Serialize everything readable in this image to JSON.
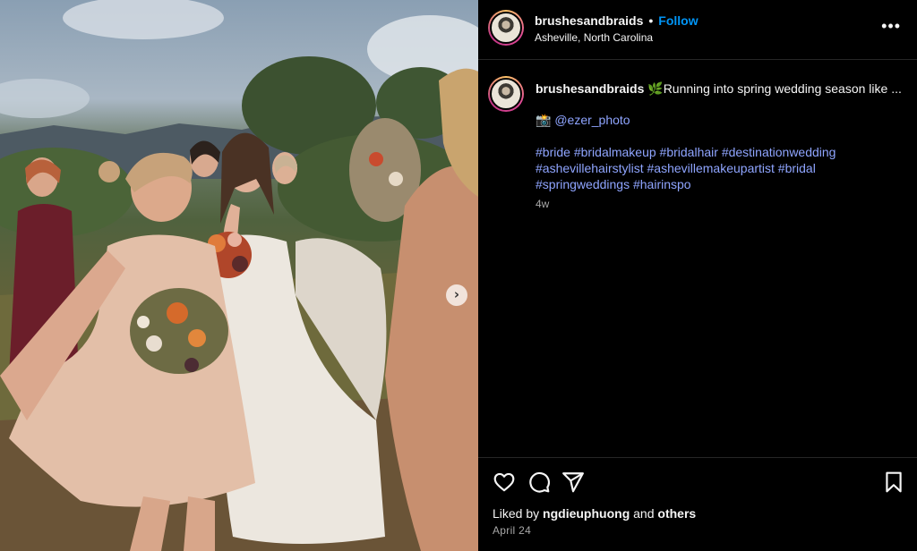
{
  "post": {
    "username": "brushesandbraids",
    "follow_label": "Follow",
    "dot": "•",
    "location": "Asheville, North Carolina",
    "more_label": "•••"
  },
  "caption": {
    "username": "brushesandbraids",
    "intro": "🌿Running into spring wedding season like ...",
    "mention_prefix": "📸 ",
    "mention": "@ezer_photo",
    "hashtags": [
      "#bride",
      "#bridalmakeup",
      "#bridalhair",
      "#destinationwedding",
      "#ashevillehairstylist",
      "#ashevillemakeupartist",
      "#bridal",
      "#springweddings",
      "#hairinspo"
    ],
    "time": "4w"
  },
  "footer": {
    "liked_prefix": "Liked by ",
    "liked_user": "ngdieuphuong",
    "liked_and": " and ",
    "liked_others": "others",
    "date": "April 24"
  },
  "carousel": {
    "next_label": "›"
  },
  "colors": {
    "background": "#000000",
    "link": "#8fa5ff",
    "follow": "#0095f6",
    "muted": "#a8a8a8",
    "divider": "#262626"
  },
  "icons": [
    "heart-icon",
    "comment-icon",
    "share-icon",
    "save-icon",
    "more-icon",
    "chevron-right-icon"
  ]
}
